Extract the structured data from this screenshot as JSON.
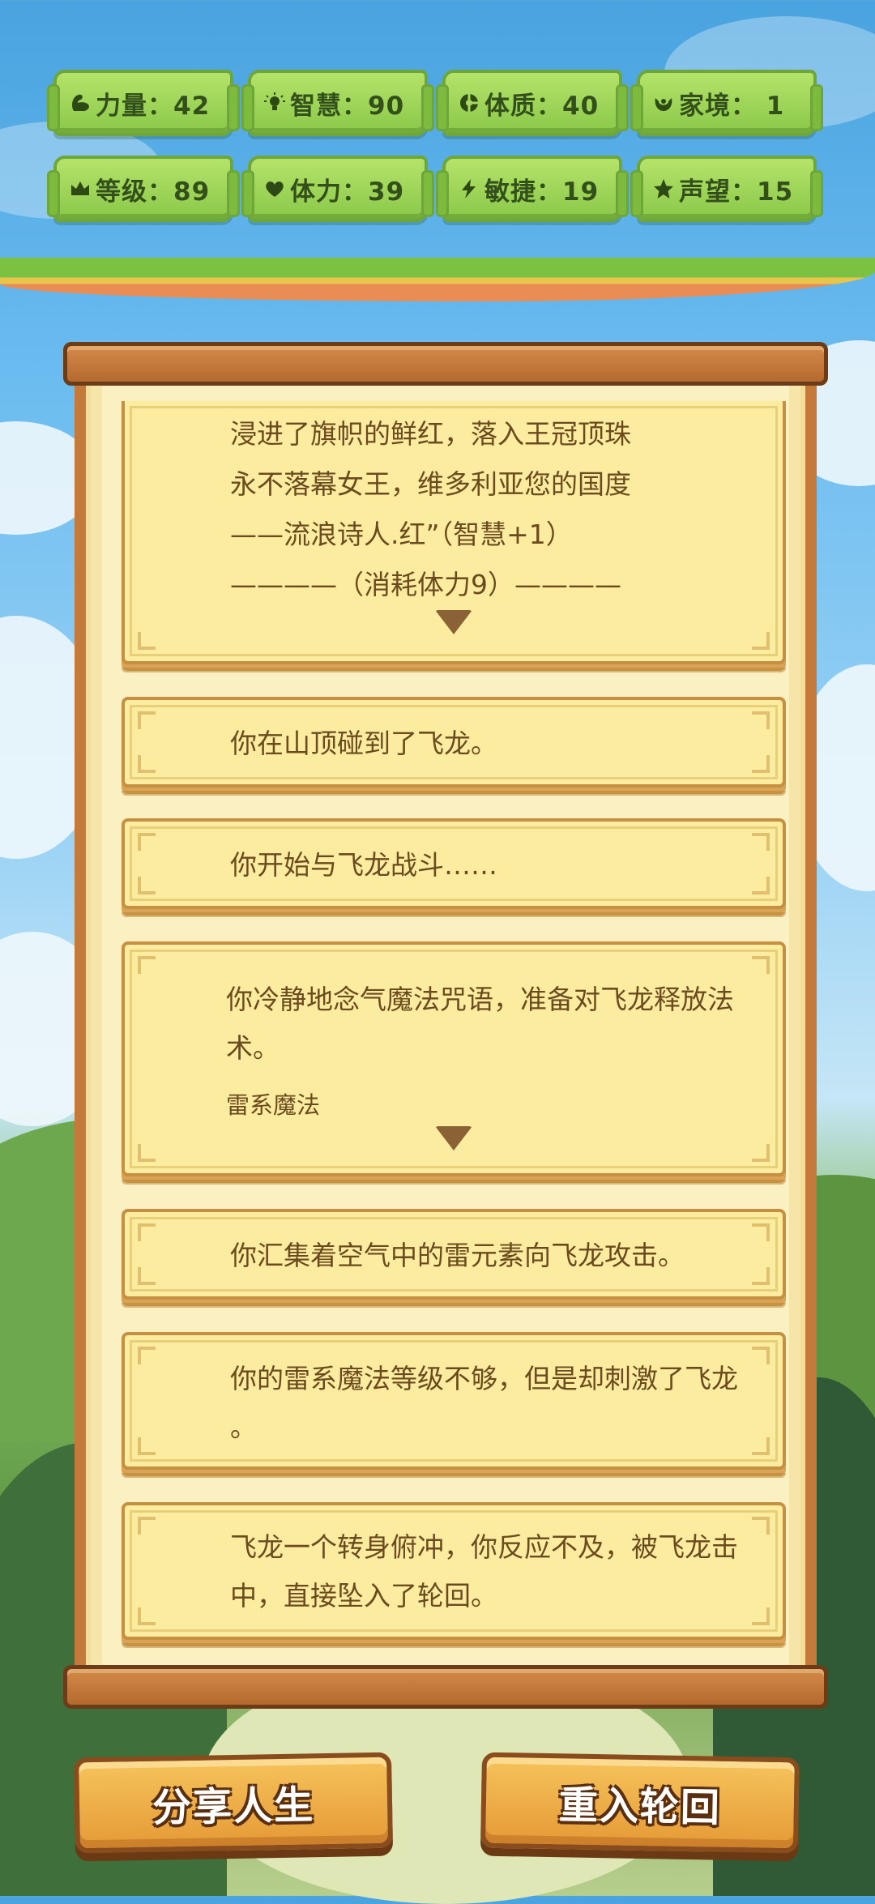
{
  "stats": [
    {
      "icon": "muscle-icon",
      "text": "力量：42"
    },
    {
      "icon": "lightbulb-icon",
      "text": "智慧：90"
    },
    {
      "icon": "constitution-icon",
      "text": "体质：40"
    },
    {
      "icon": "family-icon",
      "text": "家境：  1"
    },
    {
      "icon": "crown-icon",
      "text": "等级：89"
    },
    {
      "icon": "heart-icon",
      "text": "体力：39"
    },
    {
      "icon": "lightning-icon",
      "text": "敏捷：19"
    },
    {
      "icon": "star-icon",
      "text": "声望：15"
    }
  ],
  "log": {
    "card1": {
      "lines": [
        "浸进了旗帜的鲜红，落入王冠顶珠",
        "永不落幕女王，维多利亚您的国度",
        "——流浪诗人.红”（智慧+1）",
        "————（消耗体力9）————"
      ]
    },
    "card2": "你在山顶碰到了飞龙。",
    "card3": "你开始与飞龙战斗……",
    "card4": {
      "lines": [
        "你冷静地念气魔法咒语，准备对飞龙释放法",
        "术。"
      ],
      "sub": "雷系魔法"
    },
    "card5": "你汇集着空气中的雷元素向飞龙攻击。",
    "card6": {
      "lines": [
        "你的雷系魔法等级不够，但是却刺激了飞龙",
        "。"
      ]
    },
    "card7": {
      "lines": [
        "飞龙一个转身俯冲，你反应不及，被飞龙击",
        "中，直接坠入了轮回。"
      ]
    }
  },
  "buttons": {
    "share": "分享人生",
    "reincarnate": "重入轮回"
  }
}
